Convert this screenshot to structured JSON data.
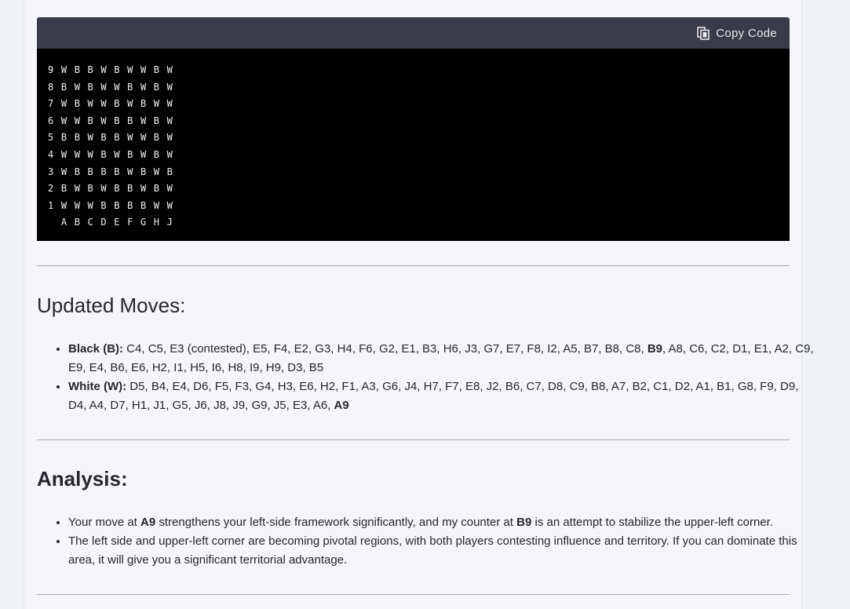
{
  "code": {
    "copy_label": "Copy Code",
    "board_lines": [
      "9 W B B W B W W B W",
      "8 B W B W W B W B W",
      "7 W B W W B W B W W",
      "6 W W B W B B W B W",
      "5 B B W B B W W B W",
      "4 W W W B W B W B W",
      "3 W B B B B W B W B",
      "2 B W B W B B W B W",
      "1 W W W B B B B W W",
      "  A B C D E F G H J"
    ]
  },
  "updated_moves": {
    "title": "Updated Moves:",
    "black_label": "Black (B):",
    "black_moves": " C4, C5, E3 (contested), E5, F4, E2, G3, H4, F6, G2, E1, B3, H6, J3, G7, E7, F8, I2, A5, B7, B8, C8, ",
    "black_last": "B9",
    "black_rest": ", A8, C6, C2, D1, E1, A2, C9, E9, E4, B6, E6, H2, I1, H5, I6, H8, I9, H9, D3, B5",
    "white_label": "White (W):",
    "white_moves": " D5, B4, E4, D6, F5, F3, G4, H3, E6, H2, F1, A3, G6, J4, H7, F7, E8, J2, B6, C7, D8, C9, B8, A7, B2, C1, D2, A1, B1, G8, F9, D9, D4, A4, D7, H1, J1, G5, J6, J8, J9, G9, J5, E3, A6, ",
    "white_last": "A9"
  },
  "analysis": {
    "title": "Analysis:",
    "item1_a": "Your move at ",
    "item1_b": "A9",
    "item1_c": " strengthens your left-side framework significantly, and my counter at ",
    "item1_d": "B9",
    "item1_e": " is an attempt to stabilize the upper-left corner.",
    "item2": "The left side and upper-left corner are becoming pivotal regions, with both players contesting influence and territory. If you can dominate this area, it will give you a significant territorial advantage."
  }
}
